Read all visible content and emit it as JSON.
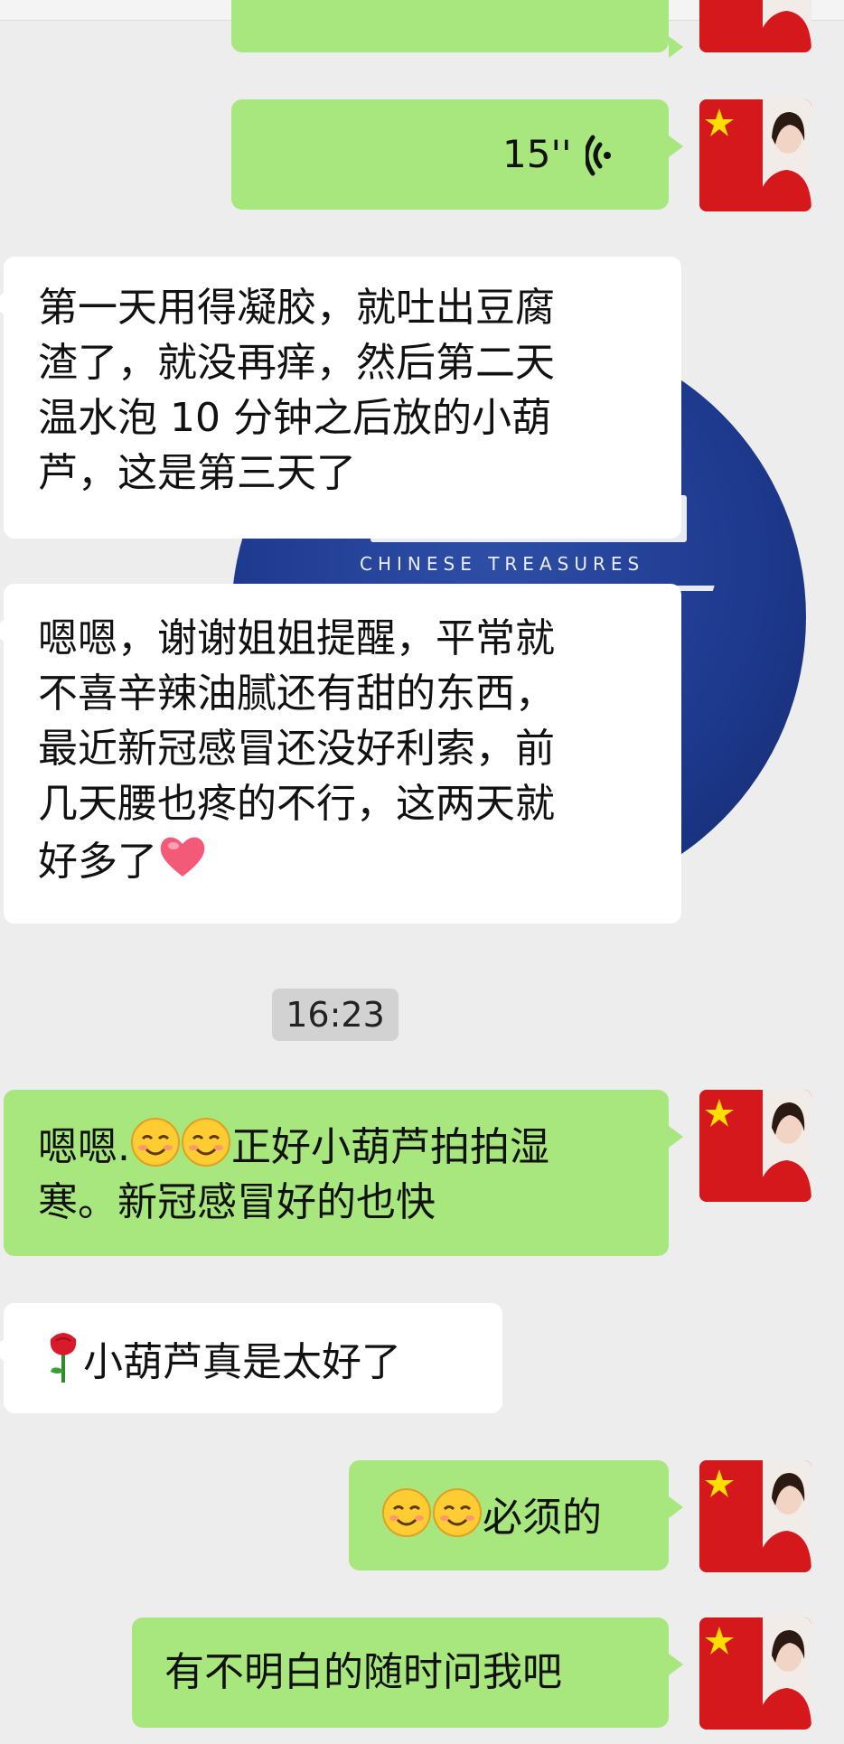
{
  "theme": {
    "chat_bg": "#ededed",
    "outgoing_bubble": "#a7e77d",
    "incoming_bubble": "#ffffff",
    "watermark_circle": "#1e3a8f"
  },
  "background_watermark": {
    "text": "CHINESE TREASURES"
  },
  "messages": [
    {
      "id": "m0",
      "direction": "outgoing",
      "type": "text-partial",
      "text": ""
    },
    {
      "id": "m1",
      "direction": "outgoing",
      "type": "voice",
      "duration": "15''",
      "icon": "voice-wave-icon"
    },
    {
      "id": "m2",
      "direction": "incoming",
      "type": "text",
      "lines": [
        "第一天用得凝胶，就吐出豆腐",
        "渣了，就没再痒，然后第二天",
        "温水泡 10 分钟之后放的小葫",
        "芦，这是第三天了"
      ]
    },
    {
      "id": "m3",
      "direction": "incoming",
      "type": "text",
      "lines": [
        "嗯嗯，谢谢姐姐提醒，平常就",
        "不喜辛辣油腻还有甜的东西，",
        "最近新冠感冒还没好利索，前",
        "几天腰也疼的不行，这两天就"
      ],
      "last_line": "好多了",
      "trailing_emoji": "heart-emoji"
    },
    {
      "id": "t1",
      "type": "timestamp",
      "text": "16:23"
    },
    {
      "id": "m4",
      "direction": "outgoing",
      "type": "text",
      "prefix": "嗯嗯.",
      "emojis": [
        "smiling-face-emoji",
        "smiling-face-emoji"
      ],
      "rest_line1": "正好小葫芦拍拍湿",
      "line2": "寒。新冠感冒好的也快"
    },
    {
      "id": "m5",
      "direction": "incoming",
      "type": "text",
      "emoji": "rose-emoji",
      "text": "小葫芦真是太好了"
    },
    {
      "id": "m6",
      "direction": "outgoing",
      "type": "text",
      "emojis": [
        "smiling-face-emoji",
        "smiling-face-emoji"
      ],
      "text": "必须的"
    },
    {
      "id": "m7",
      "direction": "outgoing",
      "type": "text",
      "text": "有不明白的随时问我吧"
    }
  ],
  "avatar": {
    "description_icon": "user-avatar-icon"
  }
}
